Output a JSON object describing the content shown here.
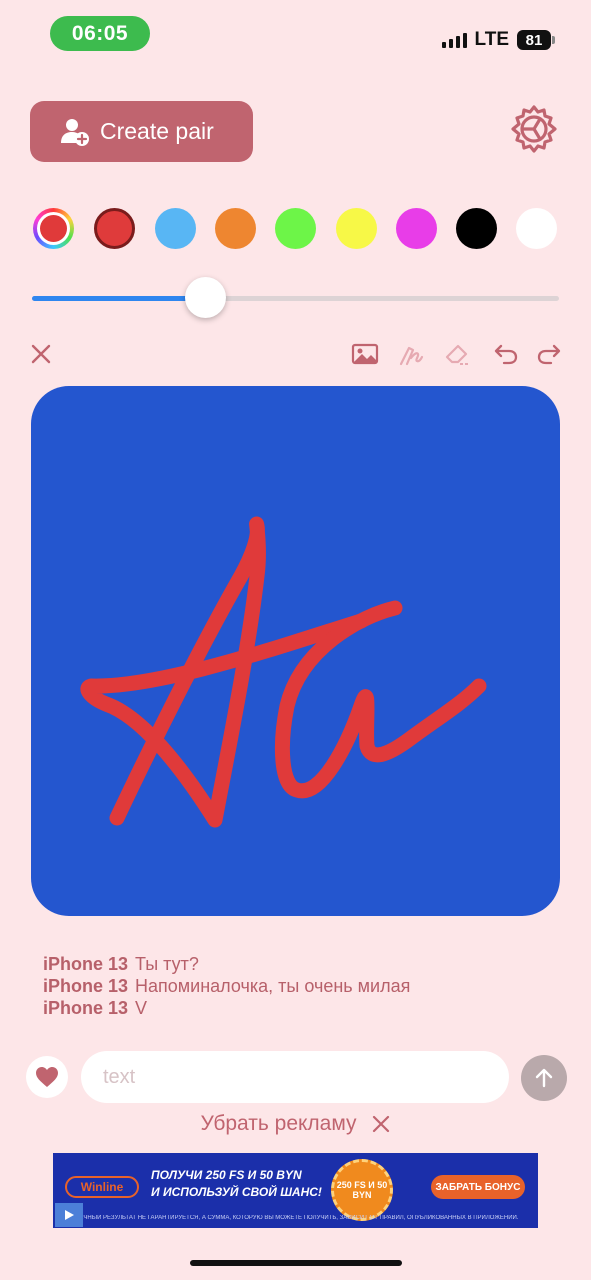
{
  "status_bar": {
    "time": "06:05",
    "network": "LTE",
    "battery": "81"
  },
  "header": {
    "create_pair_label": "Create pair"
  },
  "palette": {
    "selected": "#e03a3a",
    "colors": [
      "#df3b3b",
      "#58b6f4",
      "#ee8630",
      "#6df548",
      "#f7f847",
      "#e83de8",
      "#000000",
      "#ffffff"
    ]
  },
  "brush_size": {
    "value": 0.33
  },
  "canvas": {
    "background": "#2456cf",
    "stroke_color": "#e03a3a"
  },
  "messages": [
    {
      "sender": "iPhone 13",
      "text": "Ты тут?"
    },
    {
      "sender": "iPhone 13",
      "text": "Напоминалочка, ты очень милая"
    },
    {
      "sender": "iPhone 13",
      "text": "V"
    }
  ],
  "composer": {
    "placeholder": "text"
  },
  "remove_ads": {
    "label": "Убрать рекламу"
  },
  "ad": {
    "brand": "Winline",
    "headline_1": "ПОЛУЧИ 250 FS И 50 BYN",
    "headline_2": "И ИСПОЛЬЗУЙ СВОЙ ШАНС!",
    "chip": "250 FS И 50 BYN",
    "cta": "ЗАБРАТЬ БОНУС",
    "fine_print": "КОНЕЧНЫЙ РЕЗУЛЬТАТ НЕ ГАРАНТИРУЕТСЯ, А СУММА, КОТОРУЮ ВЫ МОЖЕТЕ ПОЛУЧИТЬ, ЗАВИСИТ ОТ ПРАВИЛ, ОПУБЛИКОВАННЫХ В ПРИЛОЖЕНИИ."
  },
  "icons": {
    "settings": "gear-icon",
    "close": "close-icon",
    "image": "image-icon",
    "pen": "pen-icon",
    "eraser": "eraser-icon",
    "undo": "undo-icon",
    "redo": "redo-icon",
    "heart": "heart-icon",
    "send": "arrow-up-icon"
  }
}
